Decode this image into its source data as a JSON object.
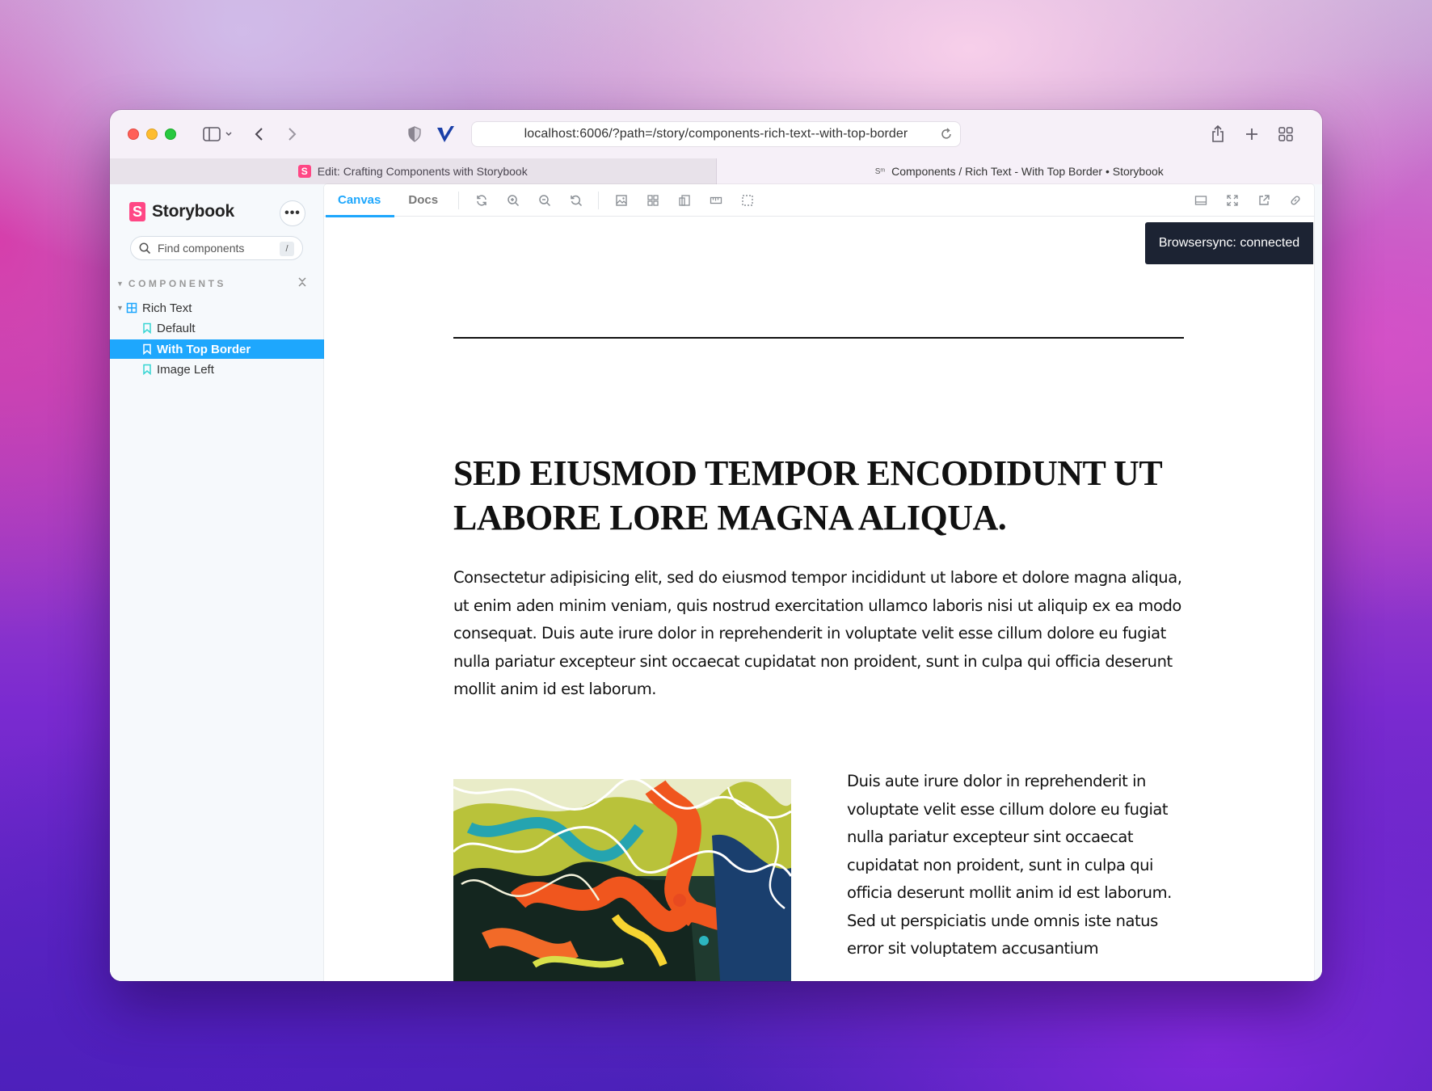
{
  "browser": {
    "url": "localhost:6006/?path=/story/components-rich-text--with-top-border",
    "tabs": [
      {
        "label": "Edit: Crafting Components with Storybook",
        "active": false
      },
      {
        "label": "Components / Rich Text - With Top Border • Storybook",
        "active": true
      }
    ],
    "favicon_letter": "S",
    "favicon2": "Sᵐ"
  },
  "sidebar": {
    "brand": "Storybook",
    "brand_letter": "S",
    "menu_label": "•••",
    "search_placeholder": "Find components",
    "search_shortcut": "/",
    "section_title": "COMPONENTS",
    "collapse_glyph": "✕",
    "component": "Rich Text",
    "stories": [
      {
        "label": "Default",
        "selected": false
      },
      {
        "label": "With Top Border",
        "selected": true
      },
      {
        "label": "Image Left",
        "selected": false
      }
    ]
  },
  "toolbar": {
    "tabs": [
      {
        "label": "Canvas",
        "active": true
      },
      {
        "label": "Docs",
        "active": false
      }
    ],
    "icons": [
      "reload-icon",
      "zoom-in-icon",
      "zoom-out-icon",
      "zoom-reset-icon",
      "background-icon",
      "grid-icon",
      "viewport-icon",
      "measure-icon",
      "outline-icon"
    ],
    "right_icons": [
      "panel-icon",
      "fullscreen-icon",
      "open-new-tab-icon",
      "copy-link-icon"
    ]
  },
  "toast": "Browsersync: connected",
  "story": {
    "heading": "SED EIUSMOD TEMPOR ENCODIDUNT UT LABORE LORE MAGNA ALIQUA.",
    "paragraph1": "Consectetur adipisicing elit, sed do eiusmod tempor incididunt ut labore et dolore magna aliqua, ut enim aden minim veniam, quis nostrud exercitation ullamco laboris nisi ut aliquip ex ea modo consequat. Duis aute irure dolor in reprehenderit in voluptate velit esse cillum dolore eu fugiat nulla pariatur excepteur sint occaecat cupidatat non proident, sunt in culpa qui officia deserunt mollit anim id est laborum.",
    "paragraph2": "Duis aute irure dolor in reprehenderit in voluptate velit esse cillum dolore eu fugiat nulla pariatur excepteur sint occaecat cupidatat non proident, sunt in culpa qui officia deserunt mollit anim id est laborum. Sed ut perspiciatis unde omnis iste natus error sit voluptatem accusantium"
  },
  "colors": {
    "accent": "#1ea7fd",
    "storybook_pink": "#ff4785",
    "toast_bg": "#1c2333"
  }
}
